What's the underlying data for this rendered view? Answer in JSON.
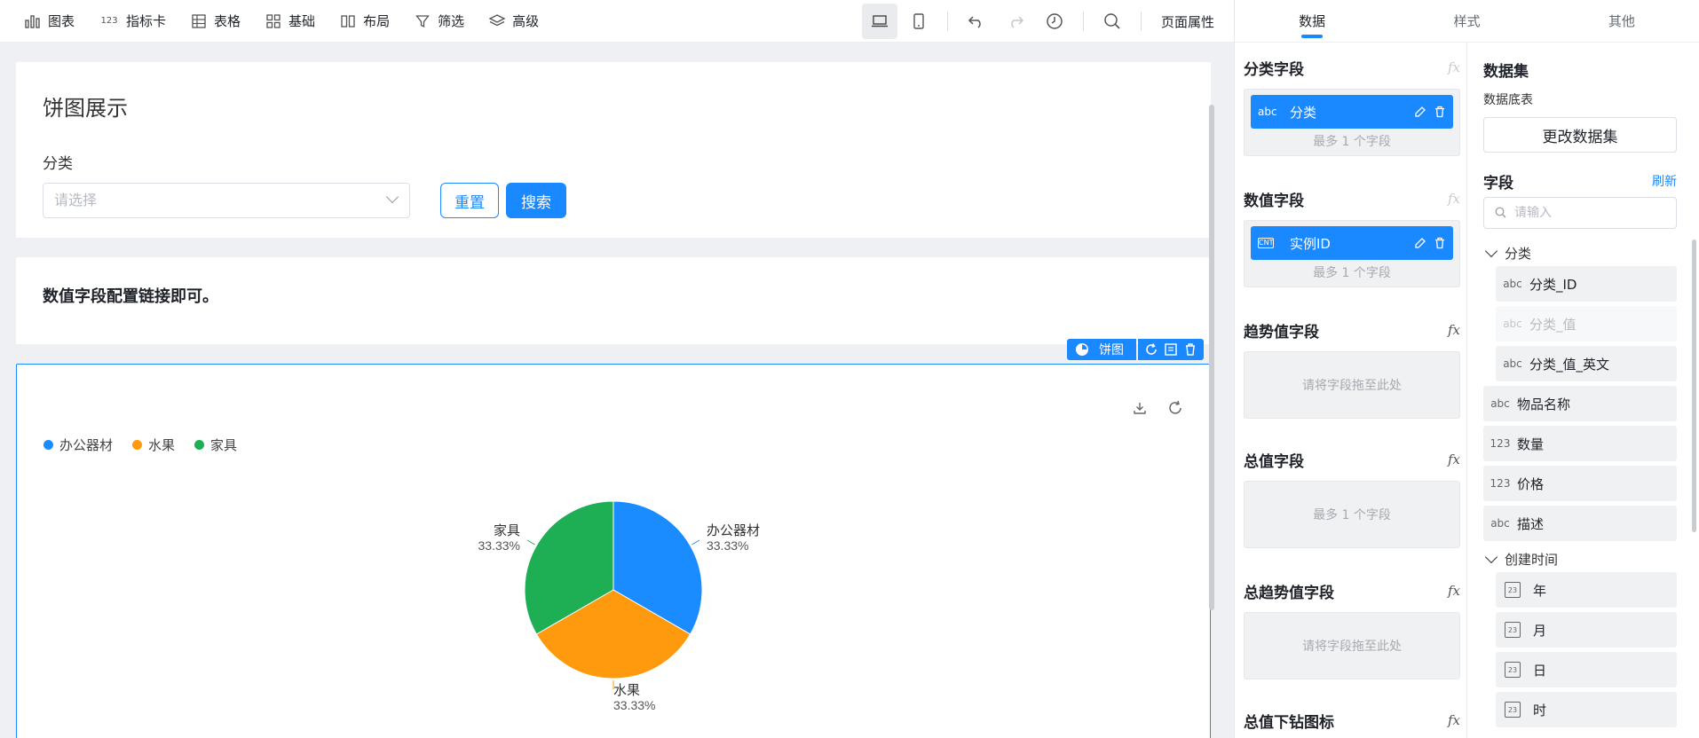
{
  "toolbar": {
    "items": [
      {
        "label": "图表",
        "icon": "bar-chart-icon"
      },
      {
        "label": "指标卡",
        "icon": "metric-card-icon"
      },
      {
        "label": "表格",
        "icon": "table-icon"
      },
      {
        "label": "基础",
        "icon": "grid-icon"
      },
      {
        "label": "布局",
        "icon": "layout-icon"
      },
      {
        "label": "筛选",
        "icon": "filter-icon"
      },
      {
        "label": "高级",
        "icon": "layers-icon"
      }
    ],
    "metric_glyph": "123",
    "page_props": "页面属性"
  },
  "filter_card": {
    "title": "饼图展示",
    "field_label": "分类",
    "select_placeholder": "请选择",
    "reset_label": "重置",
    "search_label": "搜索"
  },
  "note_card": {
    "text": "数值字段配置链接即可。"
  },
  "chart_toolbar": {
    "type_label": "饼图"
  },
  "chart_data": {
    "type": "pie",
    "categories": [
      "办公器材",
      "水果",
      "家具"
    ],
    "values": [
      33.33,
      33.33,
      33.33
    ],
    "labels": [
      "33.33%",
      "33.33%",
      "33.33%"
    ],
    "colors": [
      "#1a8cff",
      "#ff9a0f",
      "#1eaf55"
    ],
    "legend_position": "top-left"
  },
  "right_panel": {
    "tabs": [
      "数据",
      "样式",
      "其他"
    ],
    "active_tab": 0
  },
  "config": {
    "category_field": {
      "title": "分类字段",
      "chip_type": "abc",
      "chip_label": "分类",
      "hint": "最多 1 个字段"
    },
    "value_field": {
      "title": "数值字段",
      "chip_type": "CNT",
      "chip_label": "实例ID",
      "hint": "最多 1 个字段"
    },
    "trend_field": {
      "title": "趋势值字段",
      "hint": "请将字段拖至此处"
    },
    "total_field": {
      "title": "总值字段",
      "hint": "最多 1 个字段"
    },
    "total_trend_field": {
      "title": "总趋势值字段",
      "hint": "请将字段拖至此处"
    },
    "drill_field": {
      "title": "总值下钻图标"
    },
    "fx_label": "fx"
  },
  "dataset": {
    "title": "数据集",
    "subtitle": "数据底表",
    "change_label": "更改数据集",
    "fields_title": "字段",
    "refresh_label": "刷新",
    "search_placeholder": "请输入",
    "groups": [
      {
        "label": "分类"
      },
      {
        "label": "创建时间"
      }
    ],
    "category_items": [
      {
        "type": "abc",
        "label": "分类_ID"
      },
      {
        "type": "abc",
        "label": "分类_值"
      },
      {
        "type": "abc",
        "label": "分类_值_英文"
      }
    ],
    "plain_items": [
      {
        "type": "abc",
        "label": "物品名称"
      },
      {
        "type": "123",
        "label": "数量"
      },
      {
        "type": "123",
        "label": "价格"
      },
      {
        "type": "abc",
        "label": "描述"
      }
    ],
    "date_items": [
      {
        "label": "年"
      },
      {
        "label": "月"
      },
      {
        "label": "日"
      },
      {
        "label": "时"
      }
    ],
    "date_glyph": "23"
  }
}
